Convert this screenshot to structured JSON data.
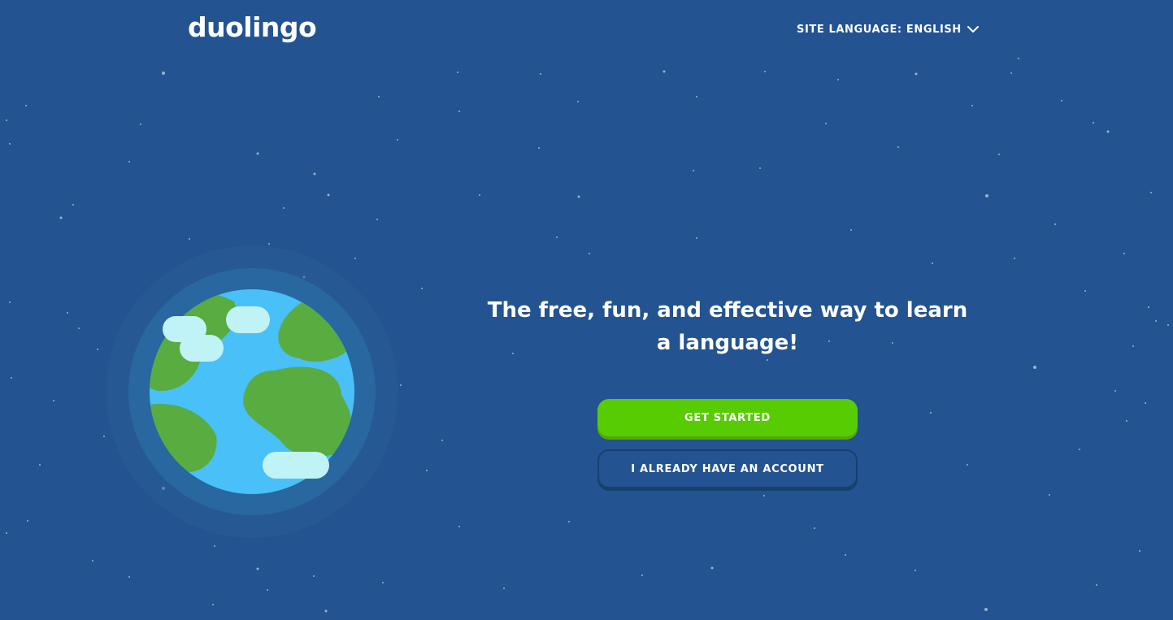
{
  "header": {
    "logo_text": "duolingo",
    "site_language_label": "SITE LANGUAGE: ENGLISH",
    "site_language_icon": "chevron-down-icon"
  },
  "hero": {
    "headline": "The free, fun, and effective way to learn a language!",
    "illustration": "globe-illustration"
  },
  "actions": {
    "get_started_label": "GET STARTED",
    "have_account_label": "I ALREADY HAVE AN ACCOUNT"
  },
  "colors": {
    "background": "#235390",
    "primary_button": "#58cc02",
    "primary_button_shadow": "#58a700",
    "ocean": "#49c0f8",
    "land": "#58ac40",
    "clouds": "#bff3f6"
  }
}
